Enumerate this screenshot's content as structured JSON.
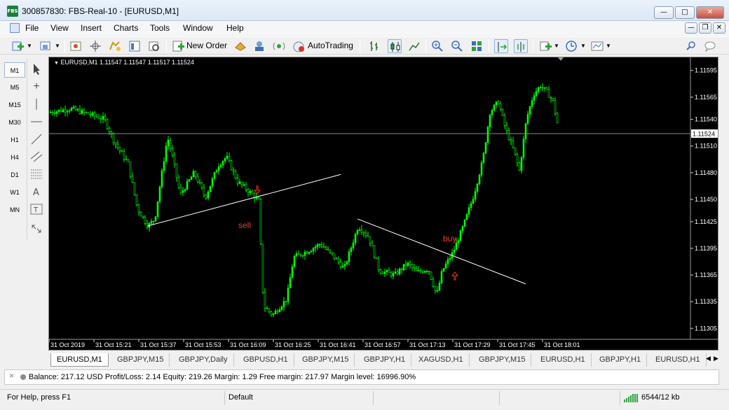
{
  "window": {
    "app_icon_text": "FBS",
    "title": "300857830: FBS-Real-10 - [EURUSD,M1]"
  },
  "menu": [
    "File",
    "View",
    "Insert",
    "Charts",
    "Tools",
    "Window",
    "Help"
  ],
  "toolbar": {
    "new_order_label": "New Order",
    "autotrading_label": "AutoTrading"
  },
  "timeframes": [
    "M1",
    "M5",
    "M15",
    "M30",
    "H1",
    "H4",
    "D1",
    "W1",
    "MN"
  ],
  "active_timeframe": "M1",
  "chart": {
    "header": "EURUSD,M1  1.11547 1.11547 1.11517 1.11524",
    "current_price_label": "1.11524",
    "price_ticks": [
      "1.11595",
      "1.11565",
      "1.11540",
      "1.11510",
      "1.11480",
      "1.11450",
      "1.11425",
      "1.11395",
      "1.11365",
      "1.11335",
      "1.11305"
    ],
    "time_ticks": [
      "31 Oct 2019",
      "31 Oct 15:21",
      "31 Oct 15:37",
      "31 Oct 15:53",
      "31 Oct 16:09",
      "31 Oct 16:25",
      "31 Oct 16:41",
      "31 Oct 16:57",
      "31 Oct 17:13",
      "31 Oct 17:29",
      "31 Oct 17:45",
      "31 Oct 18:01"
    ],
    "annotations": {
      "sell": "sell",
      "buy": "buy"
    },
    "colors": {
      "candles": "#00ff00",
      "background": "#000000",
      "trendline": "#ffffff",
      "annotation": "#ff3b1f"
    }
  },
  "tabs": [
    "EURUSD,M1",
    "GBPJPY,M15",
    "GBPJPY,Daily",
    "GBPUSD,H1",
    "GBPJPY,M15",
    "GBPJPY,H1",
    "XAGUSD,H1",
    "GBPJPY,M15",
    "EURUSD,H1",
    "GBPJPY,H1",
    "EURUSD,H1"
  ],
  "account_line": "Balance: 217.12 USD  Profit/Loss: 2.14  Equity: 219.26  Margin: 1.29  Free margin: 217.97  Margin level: 16996.90%",
  "status": {
    "help": "For Help, press F1",
    "profile": "Default",
    "traffic": "6544/12 kb"
  }
}
